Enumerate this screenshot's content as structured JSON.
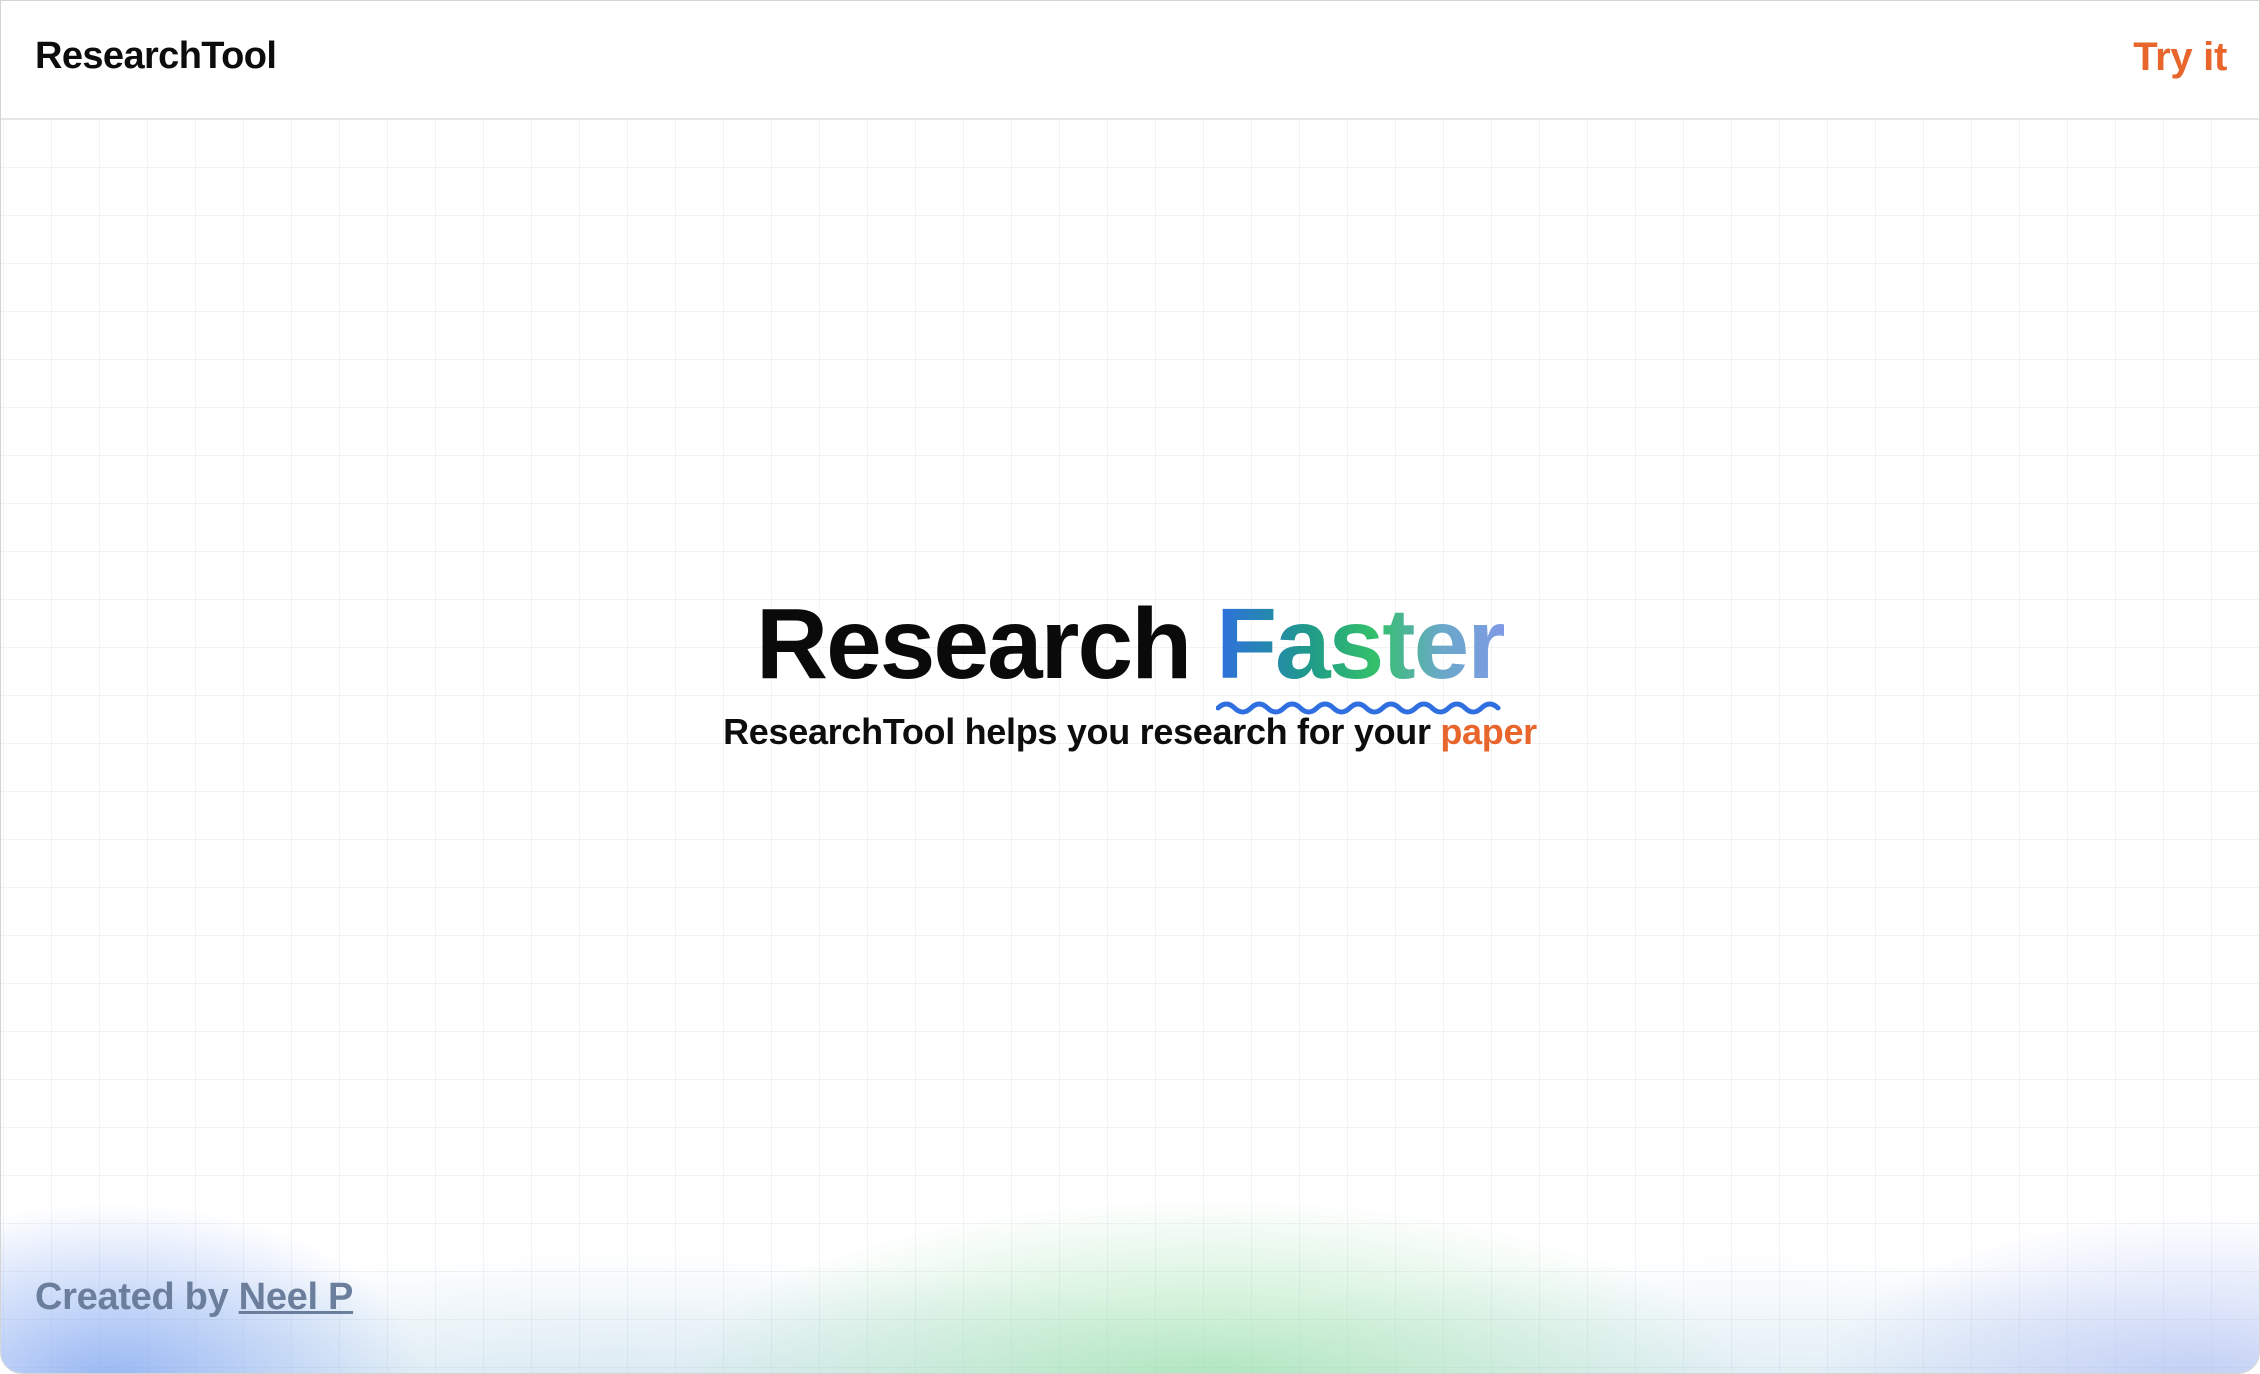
{
  "header": {
    "brand": "ResearchTool",
    "try_link": "Try it"
  },
  "hero": {
    "title_main": "Research",
    "title_accent": "Faster",
    "subtitle_main": "ResearchTool helps you research for your",
    "subtitle_accent": "paper"
  },
  "footer": {
    "credit_prefix": "Created by",
    "author_link": "Neel P"
  },
  "colors": {
    "accent_orange": "#e8652b",
    "gradient_start": "#2f6fe0",
    "gradient_mid": "#33c06a",
    "gradient_end": "#7f9ae6",
    "squiggle": "#2f6fe0",
    "footer_text": "#6b7f9c"
  }
}
